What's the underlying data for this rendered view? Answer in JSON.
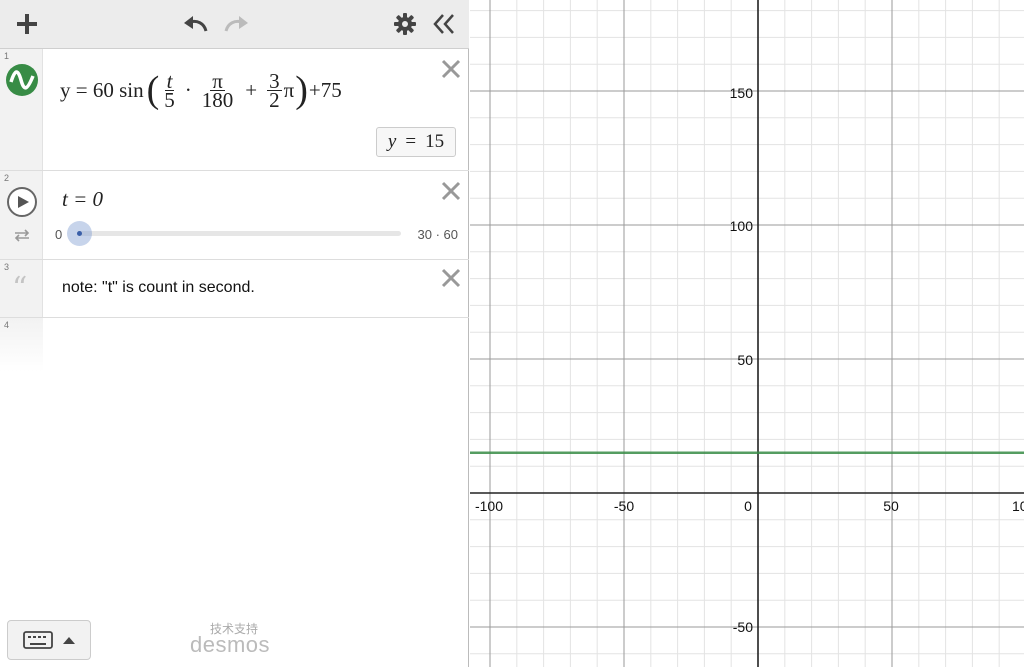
{
  "toolbar": {
    "add_icon": "plus-icon",
    "undo_icon": "undo-icon",
    "redo_icon": "redo-icon",
    "settings_icon": "gear-icon",
    "collapse_icon": "double-chevron-left-icon"
  },
  "expressions": [
    {
      "index": "1",
      "latex_parts": {
        "lhs": "y = 60 sin",
        "frac1_num": "t",
        "frac1_den": "5",
        "dot": "·",
        "frac2_num": "π",
        "frac2_den": "180",
        "plus": "+",
        "frac3_num": "3",
        "frac3_den": "2",
        "pi": "π",
        "tail": "+75"
      },
      "eval_label": "y",
      "eval_eq": "=",
      "eval_value": "15",
      "color": "#388c46"
    },
    {
      "index": "2",
      "text": "t = 0",
      "slider_min": "0",
      "slider_max": "30 · 60",
      "slider_fraction": 0
    },
    {
      "index": "3",
      "note": "note: \"t\" is count in second."
    },
    {
      "index": "4"
    }
  ],
  "footer": {
    "keyboard_icon": "keyboard-icon",
    "caret_icon": "caret-up-icon",
    "powered_by": "技术支持",
    "brand": "desmos"
  },
  "graph": {
    "x_ticks": [
      "-100",
      "-50",
      "0",
      "50",
      "10"
    ],
    "y_ticks": [
      "150",
      "100",
      "50",
      "-50"
    ],
    "line_color": "#388c46",
    "line_y_value": 15
  }
}
